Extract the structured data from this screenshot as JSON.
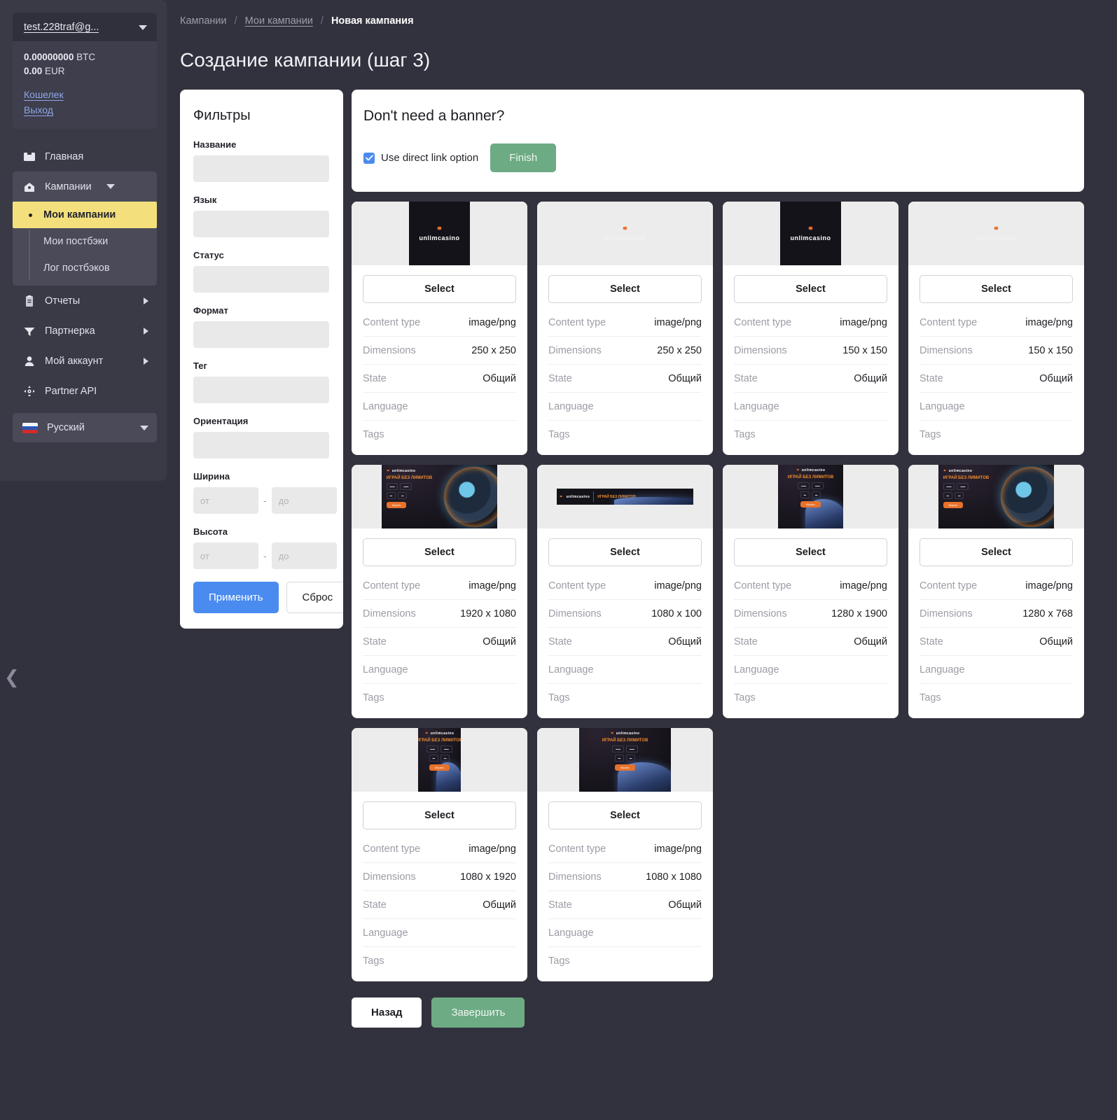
{
  "account": {
    "email": "test.228traf@g...",
    "balances": [
      {
        "amount": "0.00000000",
        "currency": "BTC"
      },
      {
        "amount": "0.00",
        "currency": "EUR"
      }
    ],
    "wallet_link": "Кошелек",
    "logout_link": "Выход"
  },
  "sidebar": {
    "items": [
      {
        "label": "Главная",
        "icon": "home-square-icon",
        "has_arrow": false
      },
      {
        "label": "Кампании",
        "icon": "campaign-icon",
        "has_arrow": true,
        "expanded": true
      },
      {
        "label": "Отчеты",
        "icon": "clipboard-icon",
        "has_arrow": true
      },
      {
        "label": "Партнерка",
        "icon": "funnel-icon",
        "has_arrow": true
      },
      {
        "label": "Мой аккаунт",
        "icon": "user-icon",
        "has_arrow": true
      },
      {
        "label": "Partner API",
        "icon": "api-nodes-icon",
        "has_arrow": false
      }
    ],
    "campaign_subitems": [
      {
        "label": "Мои кампании",
        "active": true
      },
      {
        "label": "Мои постбэки",
        "active": false
      },
      {
        "label": "Лог постбэков",
        "active": false
      }
    ],
    "language": {
      "label": "Русский",
      "flag": "ru-flag-icon"
    },
    "collapse_glyph": "❮"
  },
  "breadcrumb": {
    "items": [
      "Кампании",
      "Мои кампании"
    ],
    "current": "Новая кампания",
    "separator": "/"
  },
  "page": {
    "title": "Создание кампании (шаг 3)"
  },
  "filters": {
    "heading": "Фильтры",
    "fields": [
      {
        "label": "Название",
        "value": "",
        "placeholder": ""
      },
      {
        "label": "Язык",
        "value": "",
        "placeholder": ""
      },
      {
        "label": "Статус",
        "value": "",
        "placeholder": ""
      },
      {
        "label": "Формат",
        "value": "",
        "placeholder": ""
      },
      {
        "label": "Тег",
        "value": "",
        "placeholder": ""
      },
      {
        "label": "Ориентация",
        "value": "",
        "placeholder": ""
      }
    ],
    "ranges": [
      {
        "label": "Ширина",
        "from_placeholder": "от",
        "to_placeholder": "до",
        "dash": "-"
      },
      {
        "label": "Высота",
        "from_placeholder": "от",
        "to_placeholder": "до",
        "dash": "-"
      }
    ],
    "apply_label": "Применить",
    "reset_label": "Сброс"
  },
  "direct_link": {
    "heading": "Don't need a banner?",
    "checkbox_label": "Use direct link option",
    "checkbox_checked": true,
    "finish_label": "Finish"
  },
  "banner_card_labels": {
    "select": "Select",
    "content_type": "Content type",
    "dimensions": "Dimensions",
    "state": "State",
    "language": "Language",
    "tags": "Tags"
  },
  "banners": [
    {
      "content_type": "image/png",
      "dimensions": "250 x 250",
      "state": "Общий",
      "language": "",
      "tags": "",
      "art": {
        "kind": "logo-dark",
        "width_pct": 35,
        "brand": "unlimcasino"
      }
    },
    {
      "content_type": "image/png",
      "dimensions": "250 x 250",
      "state": "Общий",
      "language": "",
      "tags": "",
      "art": {
        "kind": "logo-light",
        "width_pct": 100,
        "brand": "unlimcasino"
      }
    },
    {
      "content_type": "image/png",
      "dimensions": "150 x 150",
      "state": "Общий",
      "language": "",
      "tags": "",
      "art": {
        "kind": "logo-dark",
        "width_pct": 35,
        "brand": "unlimcasino"
      }
    },
    {
      "content_type": "image/png",
      "dimensions": "150 x 150",
      "state": "Общий",
      "language": "",
      "tags": "",
      "art": {
        "kind": "logo-light",
        "width_pct": 100,
        "brand": "unlimcasino"
      }
    },
    {
      "content_type": "image/png",
      "dimensions": "1920 x 1080",
      "state": "Общий",
      "language": "",
      "tags": "",
      "art": {
        "kind": "promo-wide",
        "width_pct": 66,
        "brand": "unlimcasino",
        "headline": "ИГРАЙ БЕЗ ЛИМИТОВ",
        "cta": "Играть"
      }
    },
    {
      "content_type": "image/png",
      "dimensions": "1080 x 100",
      "state": "Общий",
      "language": "",
      "tags": "",
      "art": {
        "kind": "promo-strip",
        "width_pct": 78,
        "brand": "unlimcasino",
        "headline": "ИГРАЙ БЕЗ ЛИМИТОВ"
      }
    },
    {
      "content_type": "image/png",
      "dimensions": "1280 x 1900",
      "state": "Общий",
      "language": "",
      "tags": "",
      "art": {
        "kind": "promo-tall",
        "width_pct": 37,
        "brand": "unlimcasino",
        "headline": "ИГРАЙ БЕЗ ЛИМИТОВ",
        "cta": "Играть"
      }
    },
    {
      "content_type": "image/png",
      "dimensions": "1280 x 768",
      "state": "Общий",
      "language": "",
      "tags": "",
      "art": {
        "kind": "promo-wide",
        "width_pct": 66,
        "brand": "unlimcasino",
        "headline": "ИГРАЙ БЕЗ ЛИМИТОВ",
        "cta": "Играть"
      }
    },
    {
      "content_type": "image/png",
      "dimensions": "1080 x 1920",
      "state": "Общий",
      "language": "",
      "tags": "",
      "art": {
        "kind": "promo-tall",
        "width_pct": 24,
        "brand": "unlimcasino",
        "headline": "ИГРАЙ БЕЗ ЛИМИТОВ",
        "cta": "Играть"
      }
    },
    {
      "content_type": "image/png",
      "dimensions": "1080 x 1080",
      "state": "Общий",
      "language": "",
      "tags": "",
      "art": {
        "kind": "promo-square",
        "width_pct": 52,
        "brand": "unlimcasino",
        "headline": "ИГРАЙ БЕЗ ЛИМИТОВ",
        "cta": "Играть"
      }
    }
  ],
  "footer": {
    "back_label": "Назад",
    "finish_label": "Завершить"
  },
  "colors": {
    "page_bg": "#32323e",
    "sidebar_bg": "#3a3a47",
    "accent_blue": "#4a8bf0",
    "accent_green": "#6dab84",
    "active_yellow": "#f3e07d",
    "brand_orange": "#e8722c"
  }
}
